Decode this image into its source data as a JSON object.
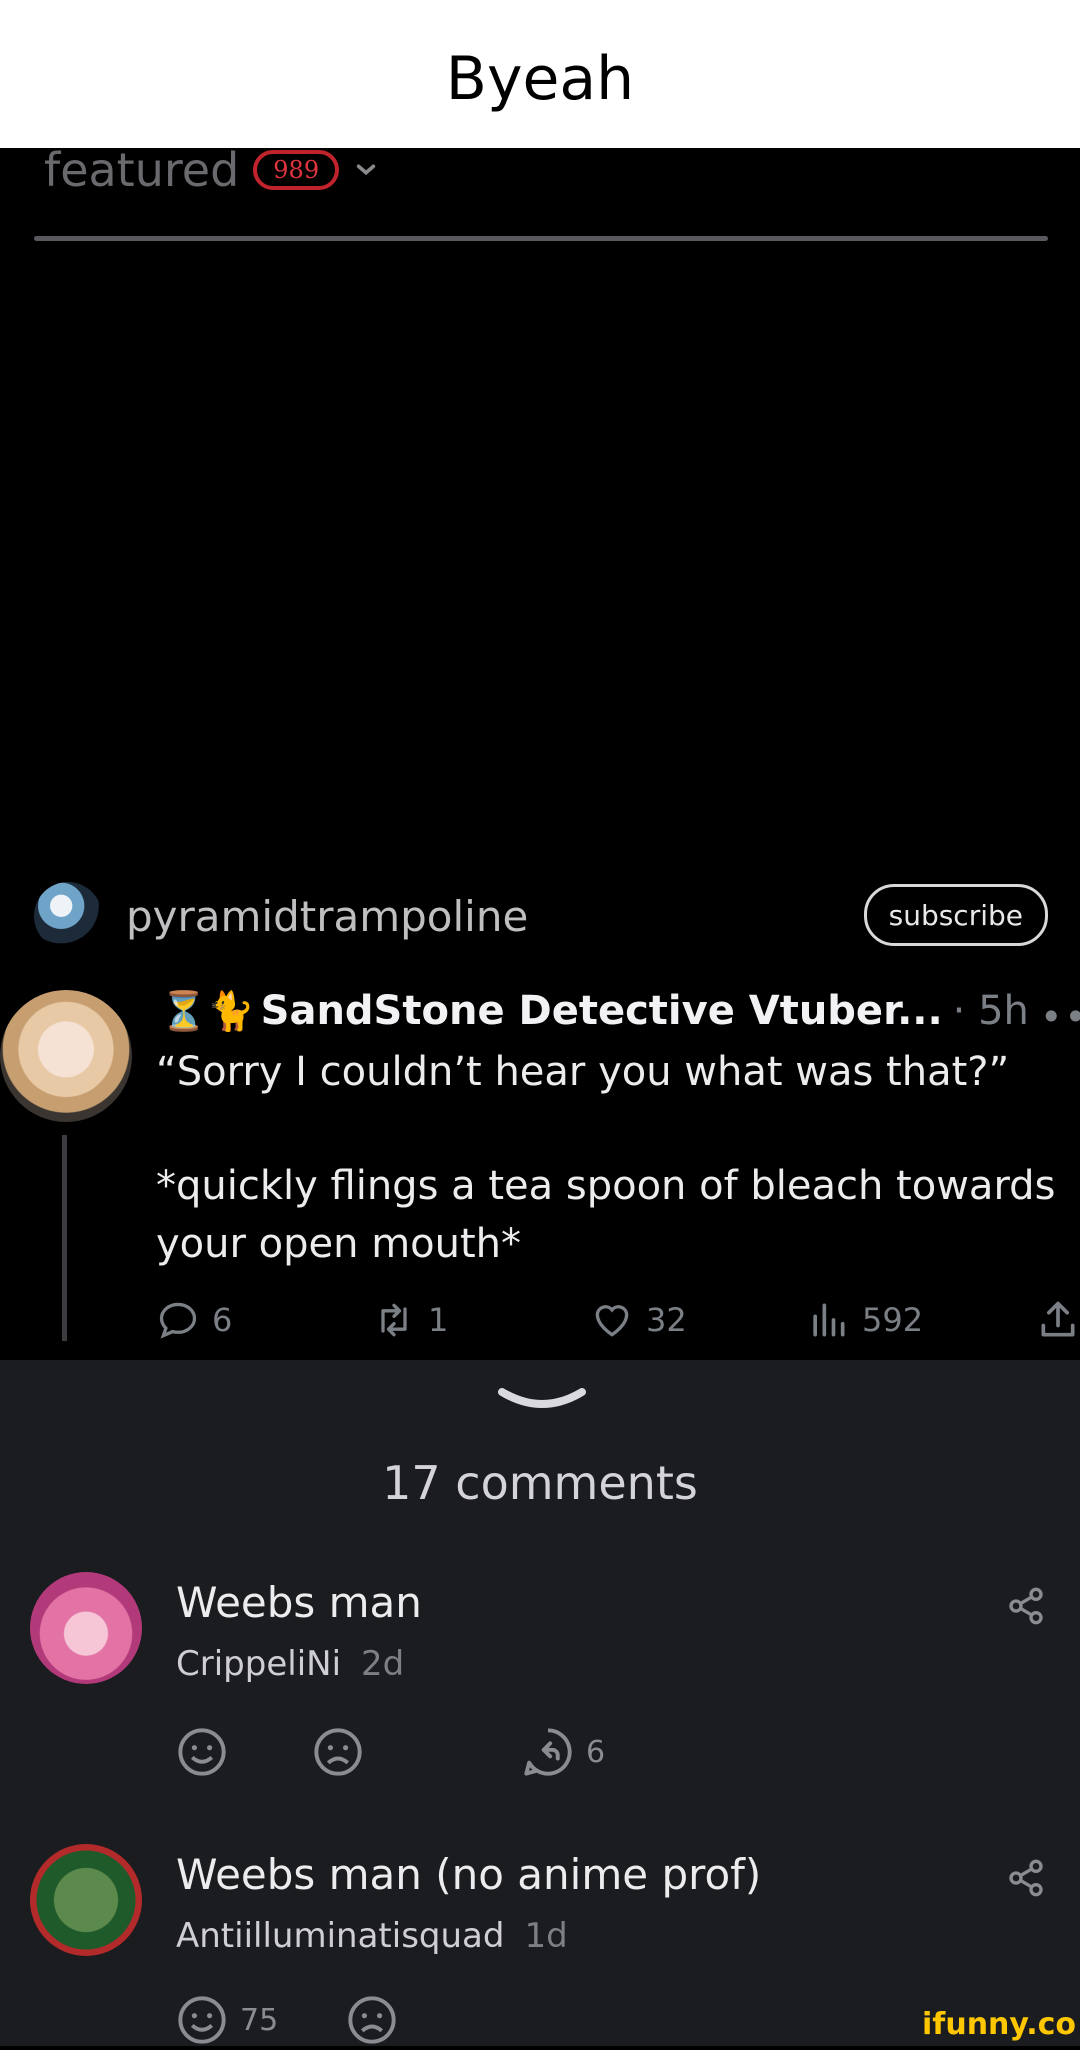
{
  "header": {
    "title": "Byeah"
  },
  "feed": {
    "tab_label": "featured",
    "count_badge": "989",
    "chevron_icon": "chevron-down-icon"
  },
  "post": {
    "username": "pyramidtrampoline",
    "subscribe_label": "subscribe",
    "tweet": {
      "emojis": "⏳🐈",
      "display_name": "SandStone Detective Vtuber...",
      "time": "· 5h",
      "more": "•••",
      "lines": [
        "“Sorry I couldn’t hear you what was that?”",
        "*quickly flings a tea spoon of bleach towards your open mouth*"
      ],
      "actions": {
        "replies": "6",
        "retweets": "1",
        "likes": "32",
        "views": "592"
      }
    }
  },
  "comments_panel": {
    "count_label": "17 comments",
    "comments": [
      {
        "title": "Weebs man",
        "author": "CrippeliNi",
        "time": "2d",
        "replies": "6"
      },
      {
        "title": "Weebs man (no anime prof)",
        "author": "Antiilluminatisquad",
        "time": "1d",
        "smile_count": "75"
      }
    ]
  },
  "watermark": "ifunny.co",
  "colors": {
    "badge": "#c0232b",
    "panel": "#1b1c20",
    "watermark": "#ffc700"
  }
}
